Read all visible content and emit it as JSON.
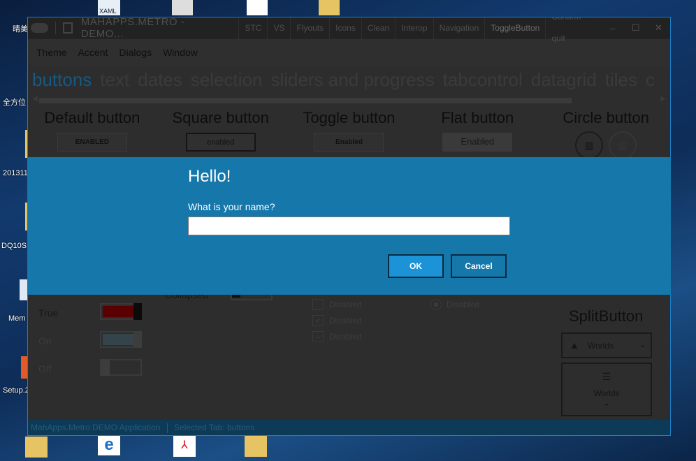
{
  "desktop": {
    "labels": [
      "晴美",
      "全方位",
      "201311",
      "DQ10S",
      "Mem",
      "Setup.2"
    ],
    "top_labels": [
      "XAML"
    ]
  },
  "window": {
    "title": "MAHAPPS.METRO - DEMO...",
    "commands": [
      "STC",
      "VS",
      "Flyouts",
      "Icons",
      "Clean",
      "Interop",
      "Navigation",
      "ToggleButton",
      "Confirm quit"
    ],
    "controls": [
      "–",
      "☐",
      "✕"
    ]
  },
  "menu": [
    "Theme",
    "Accent",
    "Dialogs",
    "Window"
  ],
  "tabs": [
    "buttons",
    "text",
    "dates",
    "selection",
    "sliders and progress",
    "tabcontrol",
    "datagrid",
    "tiles",
    "c"
  ],
  "button_demos": [
    {
      "header": "Default button",
      "label": "ENABLED"
    },
    {
      "header": "Square button",
      "label": "enabled"
    },
    {
      "header": "Toggle button",
      "label": "Enabled"
    },
    {
      "header": "Flat button",
      "label": "Enabled"
    },
    {
      "header": "Circle button",
      "label": ""
    }
  ],
  "toggles": {
    "collapsed_label": "Collapsed",
    "items": [
      "True",
      "On",
      "Off"
    ]
  },
  "checkboxes": [
    "Disabled",
    "Disabled",
    "Disabled"
  ],
  "radio_label": "Disabled",
  "split": {
    "header": "SplitButton",
    "item1": "Worlds",
    "item2": "Worlds"
  },
  "status": {
    "app": "MahApps.Metro DEMO Application",
    "tab": "Selected Tab:  buttons"
  },
  "dialog": {
    "title": "Hello!",
    "message": "What is your name?",
    "input_value": "",
    "ok": "OK",
    "cancel": "Cancel"
  },
  "colors": {
    "accent": "#1577aa",
    "ok_button": "#1b93d6",
    "active_tab": "#135a86"
  }
}
